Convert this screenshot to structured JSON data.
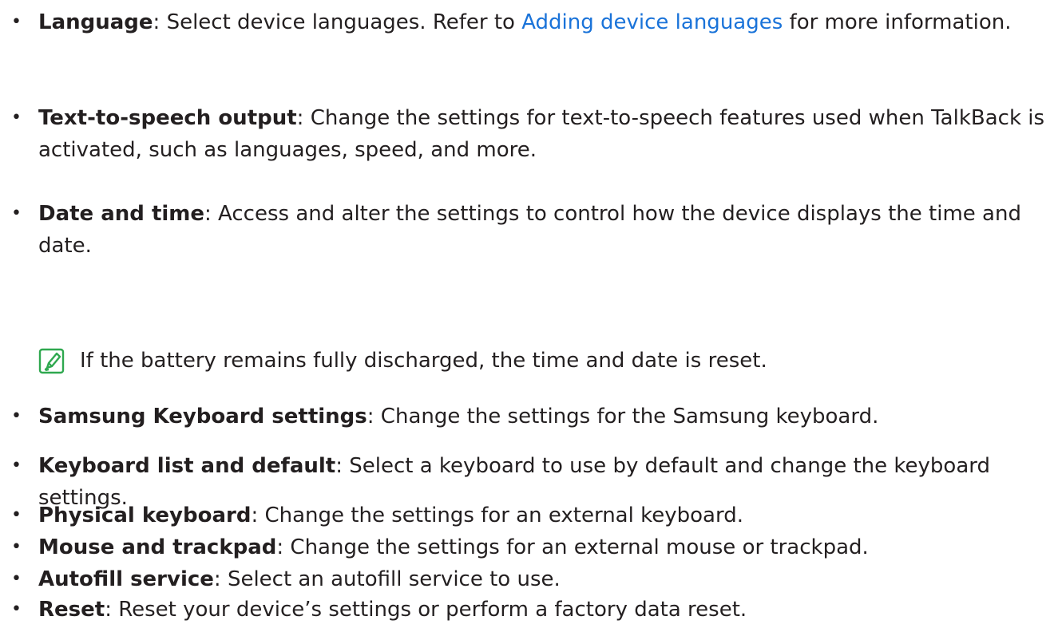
{
  "bullet_char": "•",
  "items": [
    {
      "term": "Language",
      "text_before_link": ": Select device languages. Refer to ",
      "link": "Adding device languages",
      "text_after_link": " for more information."
    },
    {
      "term": "Text-to-speech output",
      "text": ": Change the settings for text-to-speech features used when TalkBack is activated, such as languages, speed, and more."
    },
    {
      "term": "Date and time",
      "text": ": Access and alter the settings to control how the device displays the time and date."
    },
    {
      "term": "Samsung Keyboard settings",
      "text": ": Change the settings for the Samsung keyboard."
    },
    {
      "term": "Keyboard list and default",
      "text": ": Select a keyboard to use by default and change the keyboard settings."
    },
    {
      "term": "Physical keyboard",
      "text": ": Change the settings for an external keyboard."
    },
    {
      "term": "Mouse and trackpad",
      "text": ": Change the settings for an external mouse or trackpad."
    },
    {
      "term": "Autofill service",
      "text": ": Select an autofill service to use."
    },
    {
      "term": "Reset",
      "text": ": Reset your device’s settings or perform a factory data reset."
    }
  ],
  "note": {
    "icon": "note-pencil-icon",
    "text": "If the battery remains fully discharged, the time and date is reset."
  },
  "colors": {
    "text": "#231f20",
    "link": "#1a73d9",
    "note_icon": "#2fa84f"
  }
}
